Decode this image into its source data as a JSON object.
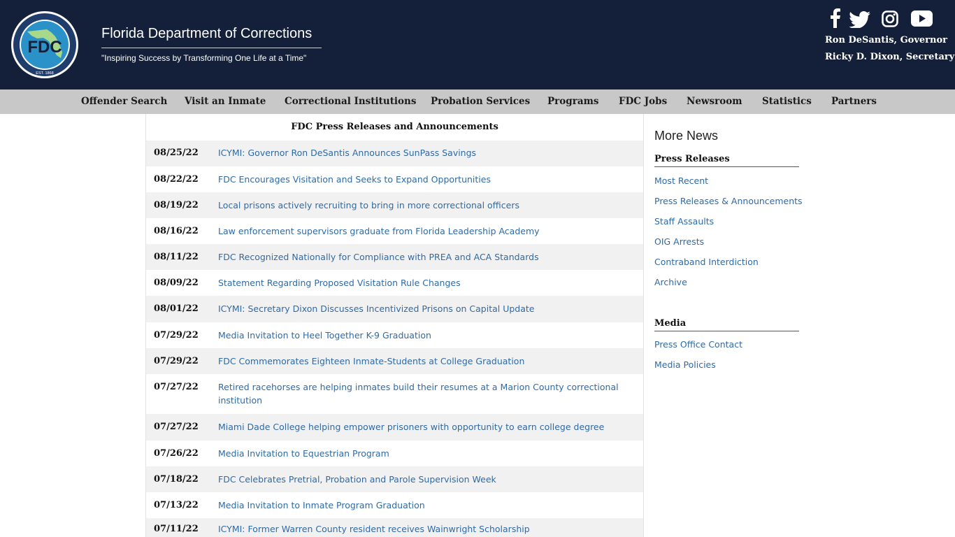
{
  "header": {
    "logo_text": "FDC",
    "logo_ring_text": "FLORIDA DEPARTMENT of CORRECTIONS",
    "logo_est": "EST. 1868",
    "title": "Florida Department of Corrections",
    "tagline": "\"Inspiring Success by Transforming One Life at a Time\"",
    "officials": [
      "Ron DeSantis, Governor",
      "Ricky D. Dixon, Secretary"
    ],
    "social_icons": [
      "facebook-icon",
      "twitter-icon",
      "instagram-icon",
      "youtube-icon"
    ]
  },
  "nav": {
    "items": [
      {
        "label": "Offender Search"
      },
      {
        "label": "Visit an Inmate"
      },
      {
        "label": "Correctional Institutions"
      },
      {
        "label": "Probation Services"
      },
      {
        "label": "Programs"
      },
      {
        "label": "FDC Jobs"
      },
      {
        "label": "Newsroom"
      },
      {
        "label": "Statistics"
      },
      {
        "label": "Partners"
      }
    ]
  },
  "main": {
    "title": "FDC Press Releases and Announcements",
    "rows": [
      {
        "date": "08/25/22",
        "title": "ICYMI: Governor Ron DeSantis Announces SunPass Savings"
      },
      {
        "date": "08/22/22",
        "title": "FDC Encourages Visitation and Seeks to Expand Opportunities"
      },
      {
        "date": "08/19/22",
        "title": "Local prisons actively recruiting to bring in more correctional officers"
      },
      {
        "date": "08/16/22",
        "title": "Law enforcement supervisors graduate from Florida Leadership Academy"
      },
      {
        "date": "08/11/22",
        "title": "FDC Recognized Nationally for Compliance with PREA and ACA Standards"
      },
      {
        "date": "08/09/22",
        "title": "Statement Regarding Proposed Visitation Rule Changes"
      },
      {
        "date": "08/01/22",
        "title": "ICYMI: Secretary Dixon Discusses Incentivized Prisons on Capital Update"
      },
      {
        "date": "07/29/22",
        "title": "Media Invitation to Heel Together K-9 Graduation"
      },
      {
        "date": "07/29/22",
        "title": "FDC Commemorates Eighteen Inmate-Students at College Graduation"
      },
      {
        "date": "07/27/22",
        "title": "Retired racehorses are helping inmates build their resumes at a Marion County correctional institution"
      },
      {
        "date": "07/27/22",
        "title": "Miami Dade College helping empower prisoners with opportunity to earn college degree"
      },
      {
        "date": "07/26/22",
        "title": "Media Invitation to Equestrian Program"
      },
      {
        "date": "07/18/22",
        "title": "FDC Celebrates Pretrial, Probation and Parole Supervision Week"
      },
      {
        "date": "07/13/22",
        "title": "Media Invitation to Inmate Program Graduation"
      },
      {
        "date": "07/11/22",
        "title": "ICYMI: Former Warren County resident receives Wainwright Scholarship"
      }
    ]
  },
  "sidebar": {
    "title": "More News",
    "press_heading": "Press Releases",
    "press_links": [
      {
        "label": "Most Recent"
      },
      {
        "label": "Press Releases & Announcements"
      },
      {
        "label": "Staff Assaults"
      },
      {
        "label": "OIG Arrests"
      },
      {
        "label": "Contraband Interdiction"
      },
      {
        "label": "Archive"
      }
    ],
    "media_heading": "Media",
    "media_links": [
      {
        "label": "Press Office Contact"
      },
      {
        "label": "Media Policies"
      }
    ]
  }
}
